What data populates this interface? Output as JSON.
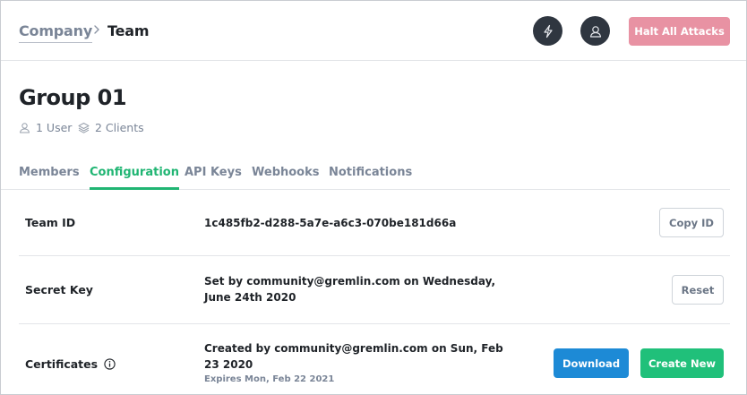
{
  "header": {
    "breadcrumb": {
      "parent": "Company",
      "current": "Team"
    },
    "icons": {
      "bolt": "lightning-bolt-icon",
      "user": "user-avatar-icon",
      "chevron": "chevron-right-icon"
    },
    "halt_button": "Halt All Attacks"
  },
  "group": {
    "title": "Group 01",
    "users": "1 User",
    "clients": "2 Clients"
  },
  "tabs": [
    {
      "label": "Members",
      "active": false
    },
    {
      "label": "Configuration",
      "active": true
    },
    {
      "label": "API Keys",
      "active": false
    },
    {
      "label": "Webhooks",
      "active": false
    },
    {
      "label": "Notifications",
      "active": false
    }
  ],
  "rows": {
    "team_id": {
      "label": "Team ID",
      "value": "1c485fb2-d288-5a7e-a6c3-070be181d66a",
      "button": "Copy ID"
    },
    "secret_key": {
      "label": "Secret Key",
      "line1": "Set by community@gremlin.com on Wednesday,",
      "line2": "June 24th 2020",
      "button": "Reset"
    },
    "certificates": {
      "label": "Certificates",
      "line1": "Created by community@gremlin.com on Sun, Feb",
      "line2": "23 2020",
      "expires": "Expires Mon, Feb 22 2021",
      "download": "Download",
      "create": "Create New"
    }
  },
  "colors": {
    "accent": "#20b573",
    "halt": "#e892a3",
    "download": "#1d8ad6",
    "create": "#20c07a",
    "dark_icon_bg": "#2f3640"
  }
}
